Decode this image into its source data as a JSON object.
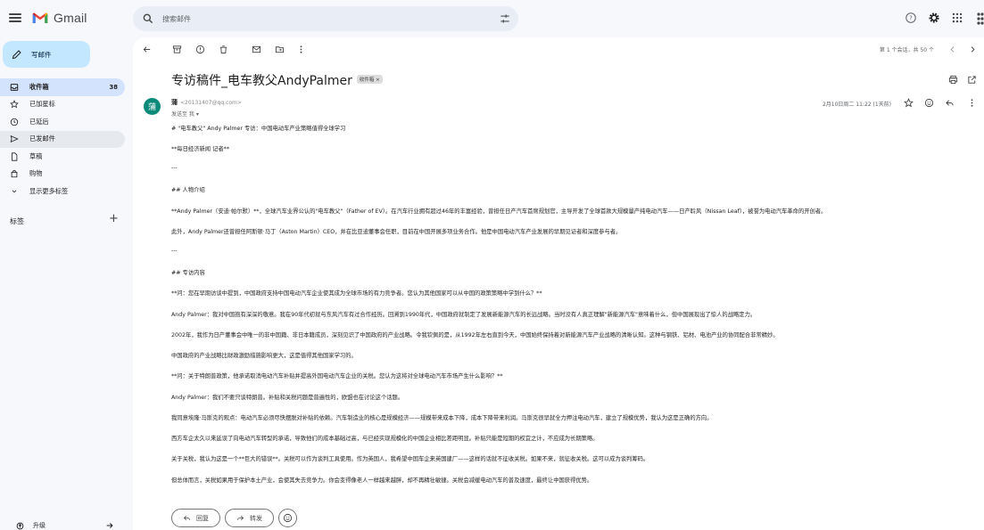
{
  "app": {
    "name": "Gmail"
  },
  "search": {
    "placeholder": "搜索邮件"
  },
  "compose": {
    "label": "写邮件"
  },
  "sidebar": {
    "items": [
      {
        "label": "收件箱",
        "count": "38",
        "icon": "inbox-icon"
      },
      {
        "label": "已加星标",
        "icon": "star-icon"
      },
      {
        "label": "已延后",
        "icon": "clock-icon"
      },
      {
        "label": "已发邮件",
        "icon": "send-icon"
      },
      {
        "label": "草稿",
        "icon": "draft-icon"
      },
      {
        "label": "购物",
        "icon": "shopping-icon"
      },
      {
        "label": "显示更多标签",
        "icon": "chevron-down-icon"
      }
    ],
    "labels_heading": "标签",
    "upgrade": "升级"
  },
  "toolbar": {
    "pager": "第 1 个会话，共 50 个"
  },
  "email": {
    "subject": "专访稿件_电车教父AndyPalmer",
    "tag": "收件箱 ×",
    "sender_name": "蒲",
    "sender_email": "<20131407@qq.com>",
    "to": "发送至 我 ▾",
    "date": "2月10日周二 11:22 (1天前)",
    "avatar_letter": "蒲",
    "paragraphs": [
      "# \"电车教父\" Andy Palmer 专访：中国电动车产业策略值得全球学习",
      "**每日经济新闻 记者**",
      "---",
      "## 人物介绍",
      "**Andy Palmer（安迪·帕尔默）**，全球汽车业界公认的\"电车教父\"（Father of EV）。在汽车行业拥有超过46年的丰富经验，曾担任日产汽车首席规划官，主导开发了全球首款大规模量产纯电动汽车——日产聆风（Nissan Leaf），被誉为电动汽车革命的开创者。",
      "此外，Andy Palmer还曾担任阿斯顿·马丁（Aston Martin）CEO，并在比亚迪董事会任职，目前在中国开展多项业务合作。他是中国电动汽车产业发展的早期见证者和深度参与者。",
      "---",
      "## 专访内容",
      "**问：您在早期访谈中提到，中国政府支持中国电动汽车企业使其成为全球市场的有力竞争者。您认为其他国家可以从中国的政策策略中学到什么？**",
      "Andy Palmer：我对中国抱有深深的敬意。我在90年代初就与东风汽车有过合作经历。回溯到1990年代，中国政府就制定了发展新能源汽车的长远战略。当时没有人真正理解\"新能源汽车\"意味着什么，但中国展现出了惊人的战略定力。",
      "2002年，我作为日产董事会中唯一的非中国籍、非日本籍成员，深刻见识了中国政府的产业战略。令我钦佩的是，从1992年左右直到今天，中国始终保持着对新能源汽车产业战略的清晰认知。这种与钢铁、铝材、电池产业的协同配合非常精妙。",
      "中国政府的产业战略比财政激励措施影响更大，这是值得其他国家学习的。",
      "**问：关于特朗普政策，他承诺取消电动汽车补贴并提高外国电动汽车企业的关税。您认为这将对全球电动汽车市场产生什么影响？**",
      "Andy Palmer：我们不要只谈特朗普。补贴和关税问题是普遍性的，欧盟也在讨论这个话题。",
      "我同意埃隆·马斯克的观点：电动汽车必须尽快摆脱对补贴的依赖。汽车制造业的核心是规模经济——规模带来成本下降，成本下降带来利润。马斯克很早就全力押注电动汽车，建立了规模优势，我认为这是正确的方向。",
      "西方车企太久以来延误了向电动汽车转型的承诺，导致他们的成本基础过高，与已经实现规模化的中国企业相比差距明显。补贴只能是短期的权宜之计，不应成为长期策略。",
      "关于关税，我认为这是一个**巨大的错误**。关税可以作为谈判工具使用。作为英国人，我希望中国车企来英国建厂——这样的话就不征收关税。如果不来，就征收关税。这可以成为谈判筹码。",
      "但总体而言，关税如果用于保护本土产业，会使其失去竞争力。你会变得像老人一样越来越胖，却不再精壮敏捷。关税会减缓电动汽车的普及速度，最终让中国获得优势。"
    ]
  },
  "actions": {
    "reply": "回复",
    "forward": "转发"
  },
  "colors": {
    "compose_bg": "#c2e7ff",
    "active_nav": "#d3e3fd",
    "avatar": "#0b8a7a",
    "app_bg": "#f6f8fc"
  }
}
